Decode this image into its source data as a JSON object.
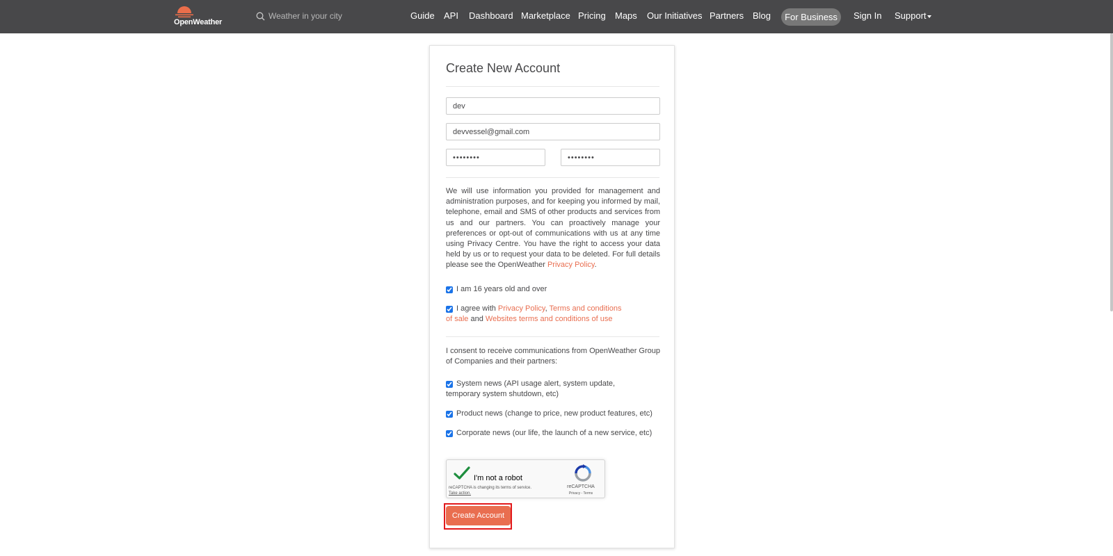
{
  "header": {
    "logo_text": "OpenWeather",
    "search_placeholder": "Weather in your city",
    "nav": {
      "guide": "Guide",
      "api": "API",
      "dashboard": "Dashboard",
      "marketplace": "Marketplace",
      "pricing": "Pricing",
      "maps": "Maps",
      "initiatives": "Our Initiatives",
      "partners": "Partners",
      "blog": "Blog",
      "business": "For Business",
      "signin": "Sign In",
      "support": "Support"
    }
  },
  "form": {
    "title": "Create New Account",
    "username": "dev",
    "email": "devvessel@gmail.com",
    "password": "••••••••",
    "password_confirm": "••••••••",
    "privacy_text": "We will use information you provided for management and administration purposes, and for keeping you informed by mail, telephone, email and SMS of other products and services from us and our partners. You can proactively manage your preferences or opt-out of communications with us at any time using Privacy Centre. You have the right to access your data held by us or to request your data to be deleted. For full details please see the OpenWeather ",
    "privacy_link": "Privacy Policy",
    "privacy_end": ".",
    "age_label": "I am 16 years old and over",
    "agree": {
      "prefix": "I agree with ",
      "privacy": "Privacy Policy",
      "comma": ", ",
      "terms": "Terms and conditions of sale",
      "and": " and ",
      "websites": "Websites terms and conditions of use"
    },
    "consent_text": "I consent to receive communications from OpenWeather Group of Companies and their partners:",
    "system_news": "System news (API usage alert, system update, temporary system shutdown, etc)",
    "product_news": "Product news (change to price, new product features, etc)",
    "corporate_news": "Corporate news (our life, the launch of a new service, etc)",
    "recaptcha": {
      "label": "I'm not a robot",
      "changing": "reCAPTCHA is changing its terms of service.",
      "take_action": "Take action.",
      "brand": "reCAPTCHA",
      "privacy_terms": "Privacy - Terms"
    },
    "submit": "Create Account"
  },
  "colors": {
    "header_bg": "#48484a",
    "accent": "#e96e50",
    "highlight": "#e2191c",
    "checkbox": "#1a73e8"
  }
}
